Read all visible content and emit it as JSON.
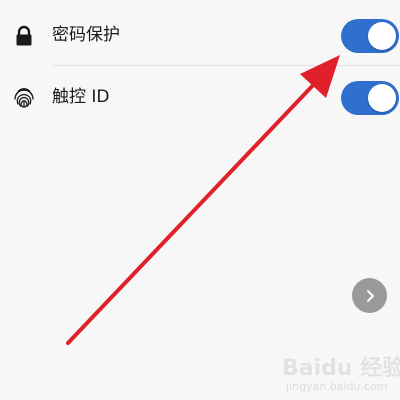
{
  "settings": {
    "items": [
      {
        "label": "密码保护",
        "icon": "lock-icon",
        "toggle_state": "on"
      },
      {
        "label": "触控 ID",
        "icon": "fingerprint-icon",
        "toggle_state": "on"
      }
    ]
  },
  "colors": {
    "toggle_on": "#2f6fce",
    "annotation_arrow": "#e0212b",
    "background": "#f7f7f7"
  },
  "navigation": {
    "next_icon": "chevron-right-icon"
  },
  "watermark": {
    "brand": "Baidu 经验",
    "url": "jingyan.baidu.com"
  }
}
